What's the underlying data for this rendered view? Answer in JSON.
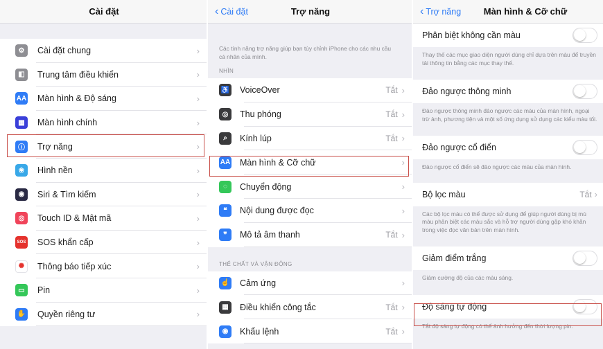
{
  "settings": {
    "title": "Cài đặt",
    "items": [
      {
        "label": "Cài đặt chung",
        "icon": "gear-icon",
        "color": "#8e8e93",
        "glyph": "⚙"
      },
      {
        "label": "Trung tâm điều khiển",
        "icon": "control-center-icon",
        "color": "#8e8e93",
        "glyph": "◧"
      },
      {
        "label": "Màn hình & Độ sáng",
        "icon": "display-brightness-icon",
        "color": "#2f7cf6",
        "glyph": "AA"
      },
      {
        "label": "Màn hình chính",
        "icon": "home-screen-icon",
        "color": "#3a3fd9",
        "glyph": "▦"
      },
      {
        "label": "Trợ năng",
        "icon": "accessibility-icon",
        "color": "#2f7cf6",
        "glyph": "ⓘ"
      },
      {
        "label": "Hình nền",
        "icon": "wallpaper-icon",
        "color": "#38a8e8",
        "glyph": "❀"
      },
      {
        "label": "Siri & Tìm kiếm",
        "icon": "siri-icon",
        "color": "#2a2a44",
        "glyph": "◉"
      },
      {
        "label": "Touch ID & Mật mã",
        "icon": "fingerprint-icon",
        "color": "#f0445a",
        "glyph": "◎"
      },
      {
        "label": "SOS khẩn cấp",
        "icon": "sos-icon",
        "color": "#e5322d",
        "glyph": "SOS"
      },
      {
        "label": "Thông báo tiếp xúc",
        "icon": "exposure-notification-icon",
        "color": "#ffffff",
        "glyph": "✺"
      },
      {
        "label": "Pin",
        "icon": "battery-icon",
        "color": "#34c759",
        "glyph": "▭"
      },
      {
        "label": "Quyền riêng tư",
        "icon": "privacy-hand-icon",
        "color": "#2f7cf6",
        "glyph": "✋"
      }
    ]
  },
  "accessibility": {
    "back": "Cài đặt",
    "title": "Trợ năng",
    "description": "Các tính năng trợ năng giúp bạn tùy chỉnh iPhone cho các nhu cầu cá nhân của mình.",
    "section_vision": "NHÌN",
    "vision_items": [
      {
        "label": "VoiceOver",
        "value": "Tắt",
        "icon": "voiceover-icon",
        "glyph": "♿"
      },
      {
        "label": "Thu phóng",
        "value": "Tắt",
        "icon": "zoom-icon",
        "glyph": "◎"
      },
      {
        "label": "Kính lúp",
        "value": "Tắt",
        "icon": "magnifier-icon",
        "glyph": "⌕"
      },
      {
        "label": "Màn hình & Cỡ chữ",
        "value": "",
        "icon": "display-text-size-icon",
        "glyph": "AA"
      },
      {
        "label": "Chuyển động",
        "value": "",
        "icon": "motion-icon",
        "glyph": "◌"
      },
      {
        "label": "Nội dung được đọc",
        "value": "",
        "icon": "spoken-content-icon",
        "glyph": "❝"
      },
      {
        "label": "Mô tả âm thanh",
        "value": "Tắt",
        "icon": "audio-description-icon",
        "glyph": "❞"
      }
    ],
    "section_physical": "THỂ CHẤT VÀ VẬN ĐỘNG",
    "physical_items": [
      {
        "label": "Cảm ứng",
        "value": "",
        "icon": "touch-icon",
        "glyph": "☝"
      },
      {
        "label": "Điều khiển công tắc",
        "value": "Tắt",
        "icon": "switch-control-icon",
        "glyph": "▦"
      },
      {
        "label": "Khẩu lệnh",
        "value": "Tắt",
        "icon": "voice-control-icon",
        "glyph": "◉"
      }
    ]
  },
  "display_text": {
    "back": "Trợ năng",
    "title": "Màn hình & Cỡ chữ",
    "items": [
      {
        "label": "Phân biệt không cần màu",
        "type": "toggle",
        "desc": "Thay thế các mục giao diện người dùng chỉ dựa trên màu để truyền tải thông tin bằng các mục thay thế."
      },
      {
        "label": "Đảo ngược thông minh",
        "type": "toggle",
        "desc": "Đảo ngược thông minh đảo ngược các màu của màn hình, ngoại trừ ảnh, phương tiện và một số ứng dụng sử dụng các kiểu màu tối."
      },
      {
        "label": "Đảo ngược cổ điển",
        "type": "toggle",
        "desc": "Đảo ngược cổ điển sẽ đảo ngược các màu của màn hình."
      },
      {
        "label": "Bộ lọc màu",
        "type": "value",
        "value": "Tắt",
        "desc": "Các bộ lọc màu có thể được sử dụng để giúp người dùng bị mù màu phân biệt các màu sắc và hỗ trợ người dùng gặp khó khăn trong việc đọc văn bản trên màn hình."
      },
      {
        "label": "Giảm điểm trắng",
        "type": "toggle",
        "desc": "Giảm cường độ của các màu sáng."
      },
      {
        "label": "Độ sáng tự động",
        "type": "toggle",
        "desc": "Tắt độ sáng tự động có thể ảnh hưởng đến thời lượng pin."
      }
    ]
  }
}
